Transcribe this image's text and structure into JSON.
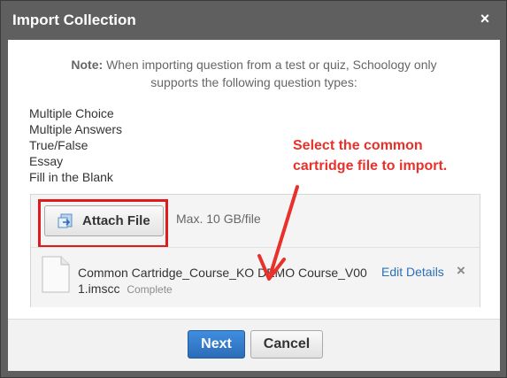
{
  "dialog": {
    "title": "Import Collection",
    "close_symbol": "×"
  },
  "note": {
    "label": "Note:",
    "line1": "When importing question from a test or quiz, Schoology only",
    "line2": "supports the following question types:"
  },
  "question_types": [
    "Multiple Choice",
    "Multiple Answers",
    "True/False",
    "Essay",
    "Fill in the Blank"
  ],
  "annotation": {
    "line1": "Select the common",
    "line2": "cartridge file to import.",
    "color": "#e8312a"
  },
  "attach": {
    "button_label": "Attach File",
    "max_size": "Max. 10 GB/file",
    "icon": "attach-file-icon",
    "highlight_color": "#e01b1b"
  },
  "file": {
    "name_line1": "Common Cartridge_Course_KO DEMO Course_V00",
    "name_line2": "1.imscc",
    "status": "Complete",
    "edit_label": "Edit Details",
    "remove_symbol": "×",
    "icon": "document-icon"
  },
  "footer": {
    "next_label": "Next",
    "cancel_label": "Cancel"
  },
  "colors": {
    "title_bg": "#5f5f5f",
    "primary_button": "#2f78cf",
    "link": "#2b6fb6"
  }
}
